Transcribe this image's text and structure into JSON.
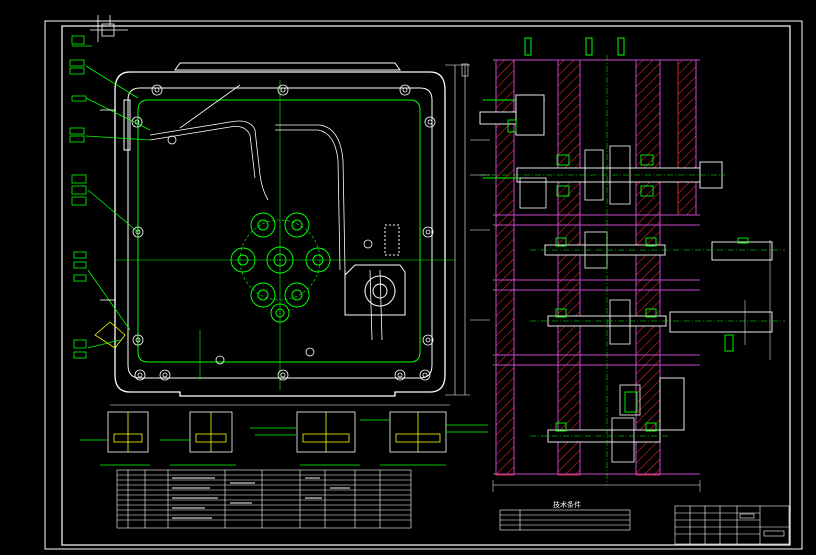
{
  "drawing": {
    "notes_heading": "技术条件",
    "colors": {
      "background": "#000000",
      "outline": "#ffffff",
      "geometry": "#00ff00",
      "section_hatch": "#ff3030",
      "bearing_plates": "#cc44cc",
      "detail_parts": "#ffff00"
    },
    "views": [
      "front-view",
      "section-view",
      "detail-sections",
      "parts-list",
      "title-block"
    ]
  }
}
